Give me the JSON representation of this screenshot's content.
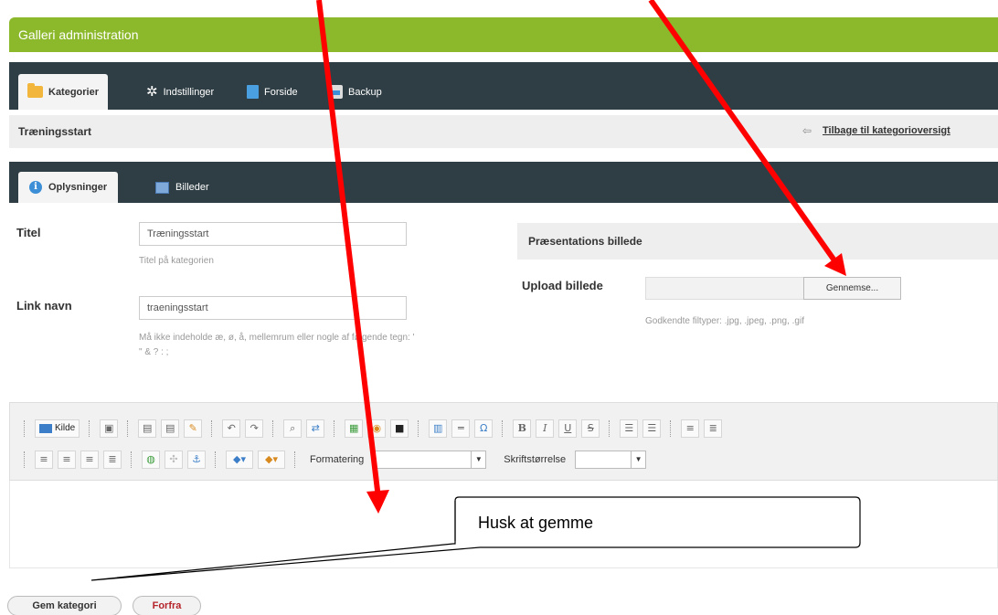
{
  "header": {
    "title": "Galleri administration"
  },
  "main_nav": {
    "tabs": [
      {
        "label": "Kategorier",
        "icon": "folder-icon",
        "active": true
      },
      {
        "label": "Indstillinger",
        "icon": "gear-icon",
        "active": false
      },
      {
        "label": "Forside",
        "icon": "document-icon",
        "active": false
      },
      {
        "label": "Backup",
        "icon": "backup-icon",
        "active": false
      }
    ]
  },
  "sub_header": {
    "title": "Træningsstart",
    "back_link": "Tilbage til kategorioversigt",
    "back_icon": "back-arrow-icon"
  },
  "sub_nav": {
    "tabs": [
      {
        "label": "Oplysninger",
        "icon": "info-icon",
        "active": true
      },
      {
        "label": "Billeder",
        "icon": "images-icon",
        "active": false
      }
    ]
  },
  "form": {
    "title": {
      "label": "Titel",
      "value": "Træningsstart",
      "hint": "Titel på kategorien"
    },
    "link_name": {
      "label": "Link navn",
      "value": "traeningsstart",
      "hint": "Må ikke indeholde æ, ø, å, mellemrum eller nogle af følgende tegn: '",
      "hint2": "\" & ? : ;"
    },
    "presentation": {
      "panel_title": "Præsentations billede",
      "upload_label": "Upload billede",
      "browse_label": "Gennemse...",
      "hint": "Godkendte filtyper: .jpg, .jpeg, .png, .gif"
    }
  },
  "editor": {
    "source_label": "Kilde",
    "format_label": "Formatering",
    "format_value": "",
    "size_label": "Skriftstørrelse",
    "size_value": "",
    "row1_icons": [
      "new-page-icon",
      "cut-icon",
      "paste-icon",
      "paste-word-icon",
      "undo-icon",
      "redo-icon",
      "find-icon",
      "replace-icon",
      "image-icon",
      "flash-icon",
      "iframe-icon",
      "table-icon",
      "horizontal-rule-icon",
      "special-char-icon",
      "bold-icon",
      "italic-icon",
      "underline-icon",
      "strikethrough-icon",
      "ordered-list-icon",
      "unordered-list-icon",
      "outdent-icon",
      "indent-icon"
    ],
    "row2_icons": [
      "align-left-icon",
      "align-center-icon",
      "align-right-icon",
      "justify-icon",
      "link-icon",
      "unlink-icon",
      "anchor-icon",
      "text-color-icon",
      "bg-color-icon"
    ]
  },
  "actions": {
    "save_label": "Gem kategori",
    "cancel_label": "Forfra"
  },
  "annotation": {
    "callout_text": "Husk at gemme",
    "arrow_color": "#ff0000"
  },
  "colors": {
    "header_green": "#8cb82b",
    "nav_dark": "#2f3e44",
    "cancel_text": "#b5242a"
  }
}
